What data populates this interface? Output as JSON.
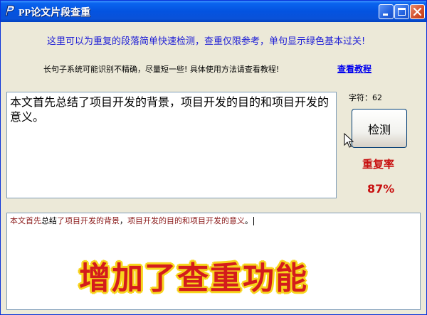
{
  "window": {
    "title": "PP论文片段查重",
    "icon": "pp-logo-icon",
    "controls": [
      "minimize-icon",
      "maximize-icon",
      "close-icon"
    ]
  },
  "info": {
    "line1": "这里可以为重复的段落简单快速检测，查重仅限参考，单句显示绿色基本过关!",
    "line2": "长句子系统可能识别不精确，尽量短一些! 具体使用方法请查看教程!",
    "tutorial_link": "查看教程"
  },
  "input": {
    "text": "本文首先总结了项目开发的背景，项目开发的目的和项目开发的意义。"
  },
  "char_count": "字符：62",
  "detect_button": "检测",
  "rate": {
    "label": "重复率",
    "value": "87%"
  },
  "output": {
    "segments": [
      {
        "text": "本文首先",
        "style": "hl"
      },
      {
        "text": "总结",
        "style": "plain"
      },
      {
        "text": "了项目开发的背景",
        "style": "hl"
      },
      {
        "text": "，",
        "style": "plain"
      },
      {
        "text": "项目开发的目的和项目开发的意义",
        "style": "hl"
      },
      {
        "text": "。",
        "style": "plain"
      }
    ]
  },
  "banner": "增加了查重功能",
  "colors": {
    "titlebar": "#0453e0",
    "info_blue": "#1b1bd6",
    "rate_red": "#c81010",
    "highlight_red": "#8b1a1a",
    "banner_red": "#d41c1c",
    "banner_outline": "#f7d51d"
  }
}
